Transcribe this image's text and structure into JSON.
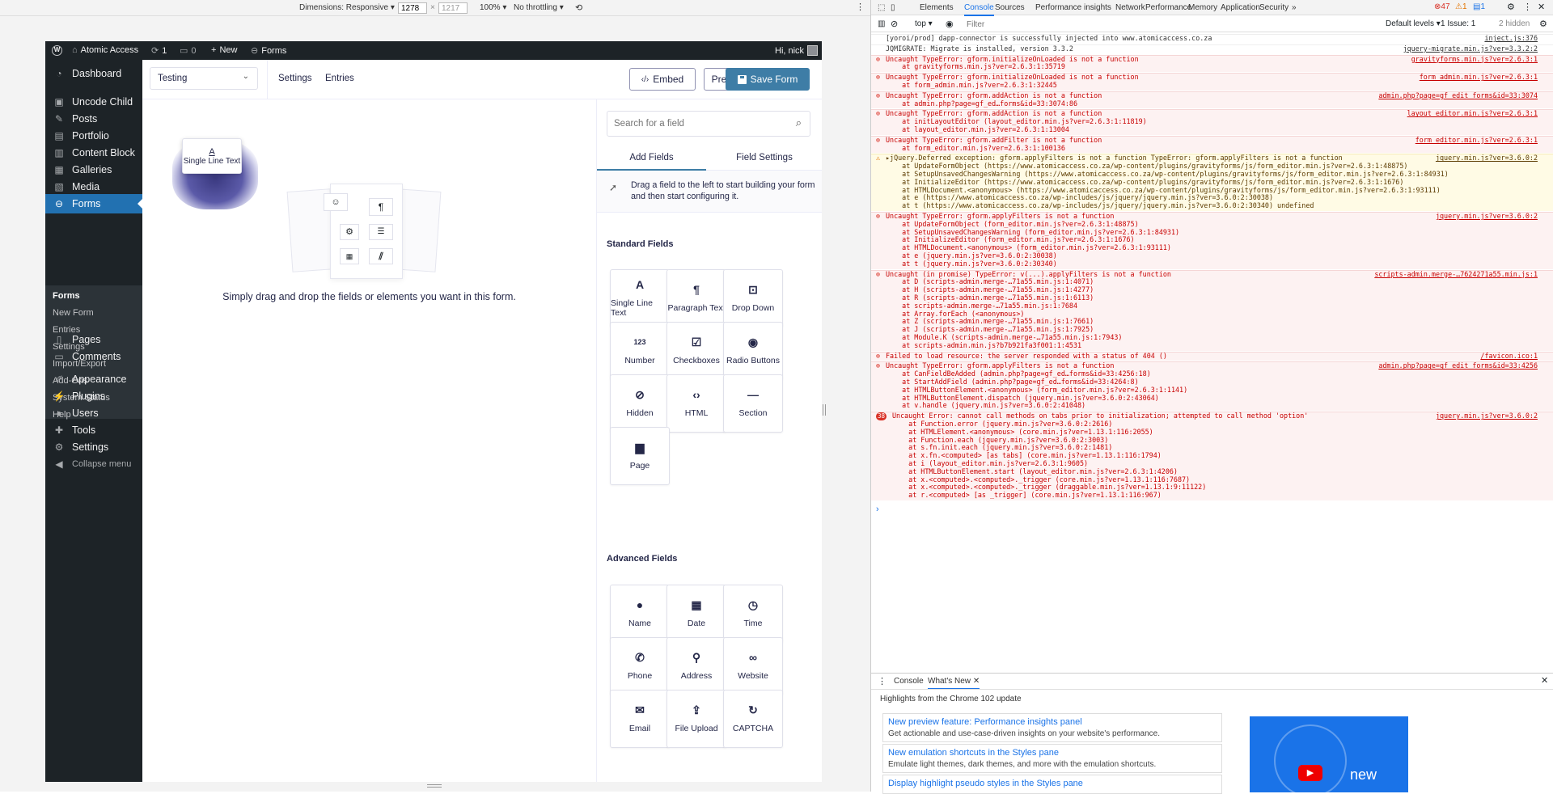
{
  "devicebar": {
    "dimensions_label": "Dimensions: Responsive ▾",
    "width": "1278",
    "height": "1217",
    "zoom": "100% ▾",
    "throttle": "No throttling ▾"
  },
  "adminbar": {
    "site_name": "Atomic Access",
    "updates_count": "1",
    "comments_count": "0",
    "new_label": "New",
    "forms_label": "Forms",
    "greeting": "Hi, nick"
  },
  "sidebar": {
    "items": [
      {
        "label": "Dashboard",
        "icon": "dashboard-icon",
        "glyph": "◔"
      },
      {
        "label": "Uncode Child",
        "icon": "uncode-icon",
        "glyph": "▣"
      },
      {
        "label": "Posts",
        "icon": "pin-icon",
        "glyph": "✎"
      },
      {
        "label": "Portfolio",
        "icon": "portfolio-icon",
        "glyph": "▤"
      },
      {
        "label": "Content Block",
        "icon": "block-icon",
        "glyph": "▥"
      },
      {
        "label": "Galleries",
        "icon": "gallery-icon",
        "glyph": "▦"
      },
      {
        "label": "Media",
        "icon": "media-icon",
        "glyph": "▧"
      },
      {
        "label": "Forms",
        "icon": "forms-icon",
        "glyph": "⊖"
      },
      {
        "label": "Pages",
        "icon": "pages-icon",
        "glyph": "▯"
      },
      {
        "label": "Comments",
        "icon": "comments-icon",
        "glyph": "▭"
      },
      {
        "label": "Appearance",
        "icon": "brush-icon",
        "glyph": "✐"
      },
      {
        "label": "Plugins",
        "icon": "plugin-icon",
        "glyph": "⚡"
      },
      {
        "label": "Users",
        "icon": "user-icon",
        "glyph": "●"
      },
      {
        "label": "Tools",
        "icon": "wrench-icon",
        "glyph": "✚"
      },
      {
        "label": "Settings",
        "icon": "settings-icon",
        "glyph": "⚙"
      },
      {
        "label": "Collapse menu",
        "icon": "collapse-icon",
        "glyph": "◀"
      }
    ],
    "submenu": [
      "Forms",
      "New Form",
      "Entries",
      "Settings",
      "Import/Export",
      "Add-Ons",
      "System Status",
      "Help"
    ]
  },
  "editor": {
    "form_select": "Testing",
    "tabs": [
      "Settings",
      "Entries"
    ],
    "embed_label": "Embed",
    "preview_label": "Preview",
    "save_label": "Save Form",
    "drag_preview_label": "Single Line Text",
    "empty_message": "Simply drag and drop the fields or elements you want in this form."
  },
  "panel": {
    "search_placeholder": "Search for a field",
    "tab_add": "Add Fields",
    "tab_settings": "Field Settings",
    "hint": "Drag a field to the left to start building your form and then start configuring it.",
    "standard_heading": "Standard Fields",
    "standard": [
      {
        "label": "Single Line Text",
        "icon": "text-icon",
        "glyph": "A"
      },
      {
        "label": "Paragraph Text",
        "icon": "paragraph-icon",
        "glyph": "¶"
      },
      {
        "label": "Drop Down",
        "icon": "dropdown-icon",
        "glyph": "⊡"
      },
      {
        "label": "Number",
        "icon": "number-icon",
        "glyph": "123"
      },
      {
        "label": "Checkboxes",
        "icon": "checkbox-icon",
        "glyph": "☑"
      },
      {
        "label": "Radio Buttons",
        "icon": "radio-icon",
        "glyph": "◉"
      },
      {
        "label": "Hidden",
        "icon": "hidden-icon",
        "glyph": "⊘"
      },
      {
        "label": "HTML",
        "icon": "code-icon",
        "glyph": "‹›"
      },
      {
        "label": "Section",
        "icon": "section-icon",
        "glyph": "—"
      },
      {
        "label": "Page",
        "icon": "page-icon",
        "glyph": "▆"
      }
    ],
    "advanced_heading": "Advanced Fields",
    "advanced": [
      {
        "label": "Name",
        "icon": "name-icon",
        "glyph": "●"
      },
      {
        "label": "Date",
        "icon": "calendar-icon",
        "glyph": "▦"
      },
      {
        "label": "Time",
        "icon": "clock-icon",
        "glyph": "◷"
      },
      {
        "label": "Phone",
        "icon": "phone-icon",
        "glyph": "✆"
      },
      {
        "label": "Address",
        "icon": "location-icon",
        "glyph": "⚲"
      },
      {
        "label": "Website",
        "icon": "link-icon",
        "glyph": "∞"
      },
      {
        "label": "Email",
        "icon": "email-icon",
        "glyph": "✉"
      },
      {
        "label": "File Upload",
        "icon": "upload-icon",
        "glyph": "⇪"
      },
      {
        "label": "CAPTCHA",
        "icon": "captcha-icon",
        "glyph": "↻"
      }
    ]
  },
  "devtools": {
    "tabs": [
      "Elements",
      "Console",
      "Sources",
      "Performance insights",
      "Network",
      "Performance",
      "Memory",
      "Application",
      "Security",
      "»"
    ],
    "error_count": "47",
    "warn_count": "1",
    "info_count": "1",
    "context": "top ▾",
    "filter_placeholder": "Filter",
    "levels": "Default levels ▾",
    "issues": "1 Issue: 1",
    "hidden": "2 hidden",
    "logs": [
      {
        "type": "info",
        "lines": [
          "[yoroi/prod] dapp-connector is successfully injected into www.atomicaccess.co.za"
        ],
        "src": "inject.js:376"
      },
      {
        "type": "info",
        "lines": [
          "JQMIGRATE: Migrate is installed, version 3.3.2"
        ],
        "src": "jquery-migrate.min.js?ver=3.3.2:2"
      },
      {
        "type": "err",
        "lines": [
          "Uncaught TypeError: gform.initializeOnLoaded is not a function",
          "    at gravityforms.min.js?ver=2.6.3:1:35719"
        ],
        "src": "gravityforms.min.js?ver=2.6.3:1"
      },
      {
        "type": "err",
        "lines": [
          "Uncaught TypeError: gform.initializeOnLoaded is not a function",
          "    at form_admin.min.js?ver=2.6.3:1:32445"
        ],
        "src": "form_admin.min.js?ver=2.6.3:1"
      },
      {
        "type": "err",
        "lines": [
          "Uncaught TypeError: gform.addAction is not a function",
          "    at admin.php?page=gf_ed…forms&id=33:3074:86"
        ],
        "src": "admin.php?page=gf_edit_forms&id=33:3074"
      },
      {
        "type": "err",
        "lines": [
          "Uncaught TypeError: gform.addAction is not a function",
          "    at initLayoutEditor (layout_editor.min.js?ver=2.6.3:1:11819)",
          "    at layout_editor.min.js?ver=2.6.3:1:13004"
        ],
        "src": "layout_editor.min.js?ver=2.6.3:1"
      },
      {
        "type": "err",
        "lines": [
          "Uncaught TypeError: gform.addFilter is not a function",
          "    at form_editor.min.js?ver=2.6.3:1:100136"
        ],
        "src": "form_editor.min.js?ver=2.6.3:1"
      },
      {
        "type": "warn",
        "lines": [
          "▸jQuery.Deferred exception: gform.applyFilters is not a function TypeError: gform.applyFilters is not a function",
          "    at UpdateFormObject (https://www.atomicaccess.co.za/wp-content/plugins/gravityforms/js/form_editor.min.js?ver=2.6.3:1:48875)",
          "    at SetupUnsavedChangesWarning (https://www.atomicaccess.co.za/wp-content/plugins/gravityforms/js/form_editor.min.js?ver=2.6.3:1:84931)",
          "    at InitializeEditor (https://www.atomicaccess.co.za/wp-content/plugins/gravityforms/js/form_editor.min.js?ver=2.6.3:1:1676)",
          "    at HTMLDocument.<anonymous> (https://www.atomicaccess.co.za/wp-content/plugins/gravityforms/js/form_editor.min.js?ver=2.6.3:1:93111)",
          "    at e (https://www.atomicaccess.co.za/wp-includes/js/jquery/jquery.min.js?ver=3.6.0:2:30038)",
          "    at t (https://www.atomicaccess.co.za/wp-includes/js/jquery/jquery.min.js?ver=3.6.0:2:30340) undefined"
        ],
        "src": "jquery.min.js?ver=3.6.0:2"
      },
      {
        "type": "err",
        "lines": [
          "Uncaught TypeError: gform.applyFilters is not a function",
          "    at UpdateFormObject (form_editor.min.js?ver=2.6.3:1:48875)",
          "    at SetupUnsavedChangesWarning (form_editor.min.js?ver=2.6.3:1:84931)",
          "    at InitializeEditor (form_editor.min.js?ver=2.6.3:1:1676)",
          "    at HTMLDocument.<anonymous> (form_editor.min.js?ver=2.6.3:1:93111)",
          "    at e (jquery.min.js?ver=3.6.0:2:30038)",
          "    at t (jquery.min.js?ver=3.6.0:2:30340)"
        ],
        "src": "jquery.min.js?ver=3.6.0:2"
      },
      {
        "type": "err",
        "lines": [
          "Uncaught (in promise) TypeError: v(...).applyFilters is not a function",
          "    at D (scripts-admin.merge-…71a55.min.js:1:4071)",
          "    at H (scripts-admin.merge-…71a55.min.js:1:4277)",
          "    at R (scripts-admin.merge-…71a55.min.js:1:6113)",
          "    at scripts-admin.merge-…71a55.min.js:1:7684",
          "    at Array.forEach (<anonymous>)",
          "    at Z (scripts-admin.merge-…71a55.min.js:1:7661)",
          "    at J (scripts-admin.merge-…71a55.min.js:1:7925)",
          "    at Module.K (scripts-admin.merge-…71a55.min.js:1:7943)",
          "    at scripts-admin.min.js?b7b921fa3f001:1:4531"
        ],
        "src": "scripts-admin.merge-…7624271a55.min.js:1"
      },
      {
        "type": "err",
        "lines": [
          "Failed to load resource: the server responded with a status of 404 ()"
        ],
        "src": "/favicon.ico:1"
      },
      {
        "type": "err",
        "lines": [
          "Uncaught TypeError: gform.applyFilters is not a function",
          "    at CanFieldBeAdded (admin.php?page=gf_ed…forms&id=33:4256:18)",
          "    at StartAddField (admin.php?page=gf_ed…forms&id=33:4264:8)",
          "    at HTMLButtonElement.<anonymous> (form_editor.min.js?ver=2.6.3:1:1141)",
          "    at HTMLButtonElement.dispatch (jquery.min.js?ver=3.6.0:2:43064)",
          "    at v.handle (jquery.min.js?ver=3.6.0:2:41048)"
        ],
        "src": "admin.php?page=gf_edit_forms&id=33:4256"
      },
      {
        "type": "err",
        "badge": "38",
        "lines": [
          "Uncaught Error: cannot call methods on tabs prior to initialization; attempted to call method 'option'",
          "    at Function.error (jquery.min.js?ver=3.6.0:2:2616)",
          "    at HTMLElement.<anonymous> (core.min.js?ver=1.13.1:116:2055)",
          "    at Function.each (jquery.min.js?ver=3.6.0:2:3003)",
          "    at s.fn.init.each (jquery.min.js?ver=3.6.0:2:1481)",
          "    at x.fn.<computed> [as tabs] (core.min.js?ver=1.13.1:116:1794)",
          "    at i (layout_editor.min.js?ver=2.6.3:1:9605)",
          "    at HTMLButtonElement.start (layout_editor.min.js?ver=2.6.3:1:4206)",
          "    at x.<computed>.<computed>._trigger (core.min.js?ver=1.13.1:116:7687)",
          "    at x.<computed>.<computed>._trigger (draggable.min.js?ver=1.13.1:9:11122)",
          "    at r.<computed> [as _trigger] (core.min.js?ver=1.13.1:116:967)"
        ],
        "src": "jquery.min.js?ver=3.6.0:2"
      }
    ],
    "prompt": "›",
    "drawer_tabs": [
      "Console",
      "What's New"
    ],
    "drawer_title": "Highlights from the Chrome 102 update",
    "cards": [
      {
        "title": "New preview feature: Performance insights panel",
        "desc": "Get actionable and use-case-driven insights on your website's performance."
      },
      {
        "title": "New emulation shortcuts in the Styles pane",
        "desc": "Emulate light themes, dark themes, and more with the emulation shortcuts."
      },
      {
        "title": "Display highlight pseudo styles in the Styles pane",
        "desc": ""
      }
    ],
    "video_word": "new"
  }
}
